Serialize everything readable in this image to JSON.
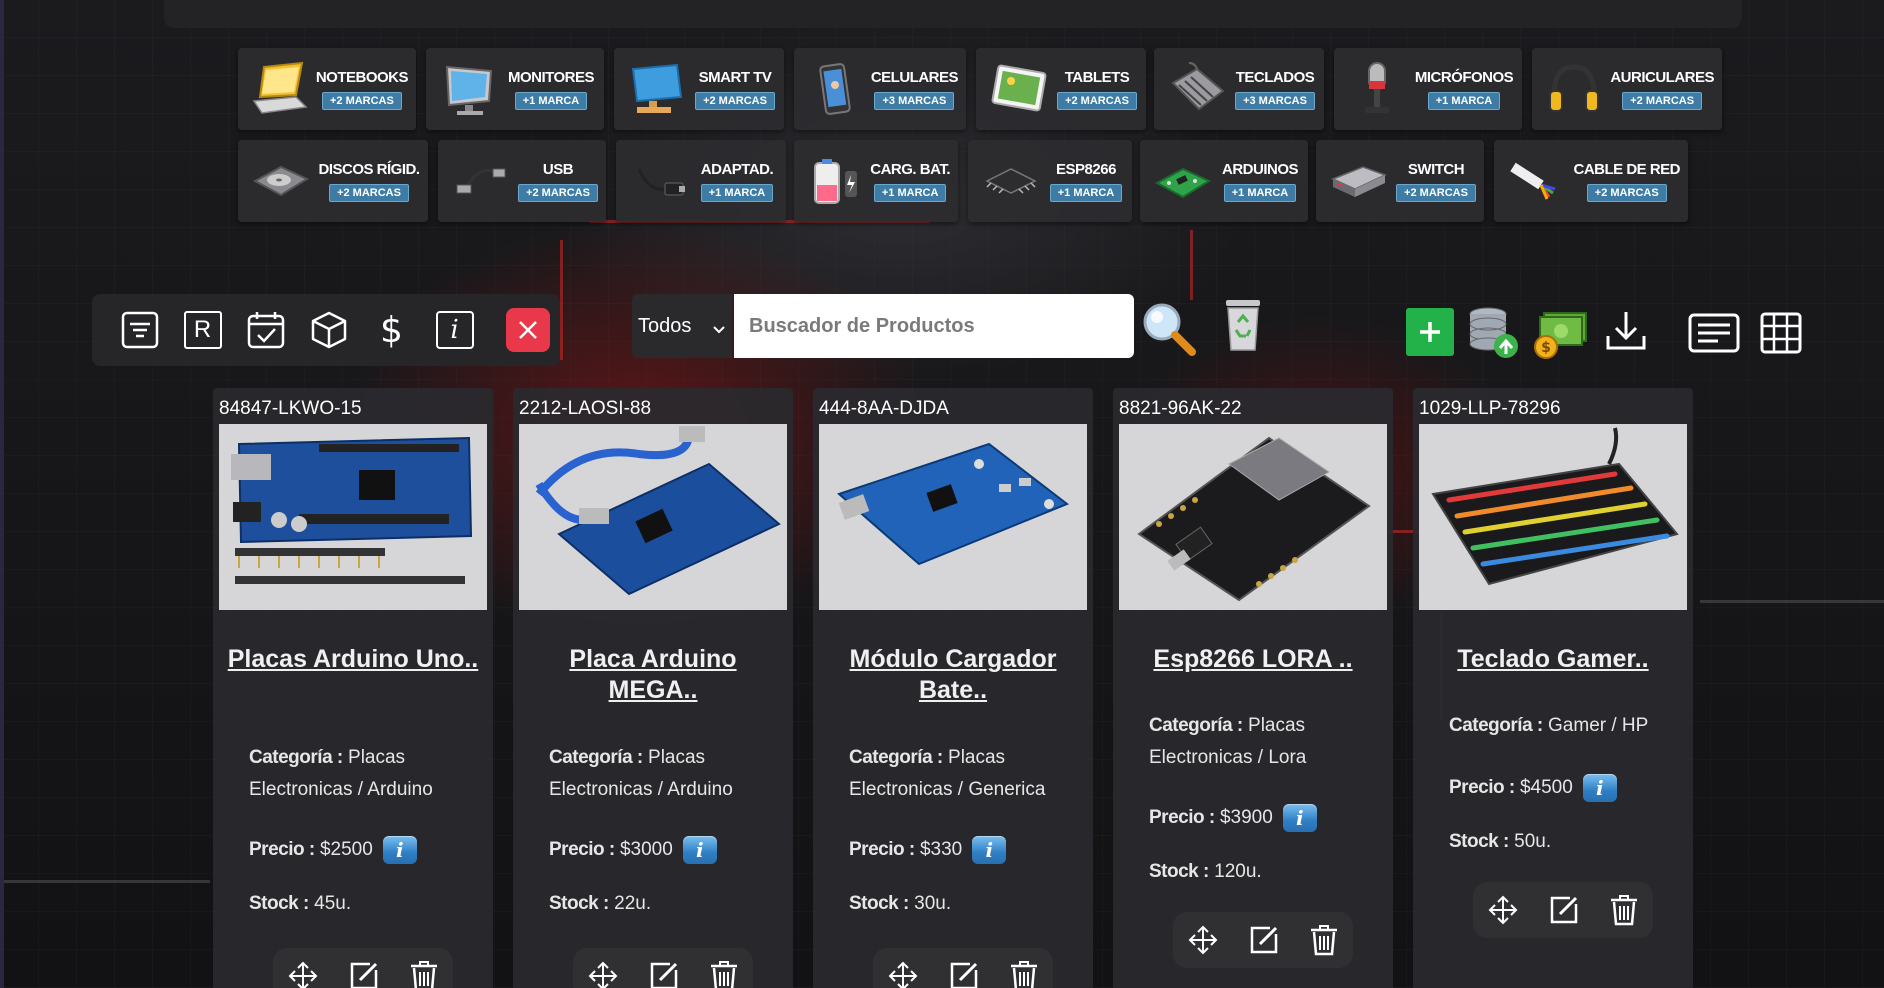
{
  "categories": [
    {
      "name": "NOTEBOOKS",
      "badge": "+2 MARCAS",
      "icon": "notebook-icon"
    },
    {
      "name": "MONITORES",
      "badge": "+1 MARCA",
      "icon": "monitor-icon"
    },
    {
      "name": "SMART TV",
      "badge": "+2 MARCAS",
      "icon": "smart-tv-icon"
    },
    {
      "name": "CELULARES",
      "badge": "+3 MARCAS",
      "icon": "phone-icon"
    },
    {
      "name": "TABLETS",
      "badge": "+2 MARCAS",
      "icon": "tablet-icon"
    },
    {
      "name": "TECLADOS",
      "badge": "+3 MARCAS",
      "icon": "keyboard-icon"
    },
    {
      "name": "MICRÓFONOS",
      "badge": "+1 MARCA",
      "icon": "microphone-icon"
    },
    {
      "name": "AURICULARES",
      "badge": "+2 MARCAS",
      "icon": "headphones-icon"
    },
    {
      "name": "DISCOS RÍGID.",
      "badge": "+2 MARCAS",
      "icon": "hard-disk-icon"
    },
    {
      "name": "USB",
      "badge": "+2 MARCAS",
      "icon": "usb-icon"
    },
    {
      "name": "ADAPTAD.",
      "badge": "+1 MARCA",
      "icon": "adapter-icon"
    },
    {
      "name": "CARG. BAT.",
      "badge": "+1 MARCA",
      "icon": "battery-charger-icon"
    },
    {
      "name": "ESP8266",
      "badge": "+1 MARCA",
      "icon": "chip-icon"
    },
    {
      "name": "ARDUINOS",
      "badge": "+1 MARCA",
      "icon": "arduino-board-icon"
    },
    {
      "name": "SWITCH",
      "badge": "+2 MARCAS",
      "icon": "network-switch-icon"
    },
    {
      "name": "CABLE DE RED",
      "badge": "+2 MARCAS",
      "icon": "network-cable-icon"
    }
  ],
  "toolbar": {
    "icons": [
      "filter-icon",
      "r-letter-icon",
      "calendar-check-icon",
      "box-icon",
      "dollar-icon",
      "info-icon",
      "close-icon"
    ],
    "r_letter": "R",
    "dollar": "$",
    "info": "i"
  },
  "search": {
    "select_value": "Todos",
    "placeholder": "Buscador de Productos"
  },
  "right_actions": [
    "add-icon",
    "database-upload-icon",
    "money-icon",
    "download-icon",
    "list-view-icon",
    "grid-view-icon"
  ],
  "labels": {
    "categoria": "Categoría :",
    "precio": "Precio :",
    "stock": "Stock :",
    "info": "i"
  },
  "products": [
    {
      "code": "84847-LKWO-15",
      "title": "Placas Arduino Uno..",
      "category": "Placas Electronicas / Arduino",
      "price": "$2500",
      "stock": "45u.",
      "image": "arduino-uno-image"
    },
    {
      "code": "2212-LAOSI-88",
      "title": "Placa Arduino MEGA..",
      "category": "Placas Electronicas / Arduino",
      "price": "$3000",
      "stock": "22u.",
      "image": "arduino-mega-image"
    },
    {
      "code": "444-8AA-DJDA",
      "title": "Módulo Cargador Bate..",
      "category": "Placas Electronicas / Generica",
      "price": "$330",
      "stock": "30u.",
      "image": "charger-module-image"
    },
    {
      "code": "8821-96AK-22",
      "title": "Esp8266 LORA ..",
      "category": "Placas Electronicas / Lora",
      "price": "$3900",
      "stock": "120u.",
      "image": "esp8266-image"
    },
    {
      "code": "1029-LLP-78296",
      "title": "Teclado Gamer..",
      "category": "Gamer / HP",
      "price": "$4500",
      "stock": "50u.",
      "image": "gamer-keyboard-image"
    }
  ]
}
